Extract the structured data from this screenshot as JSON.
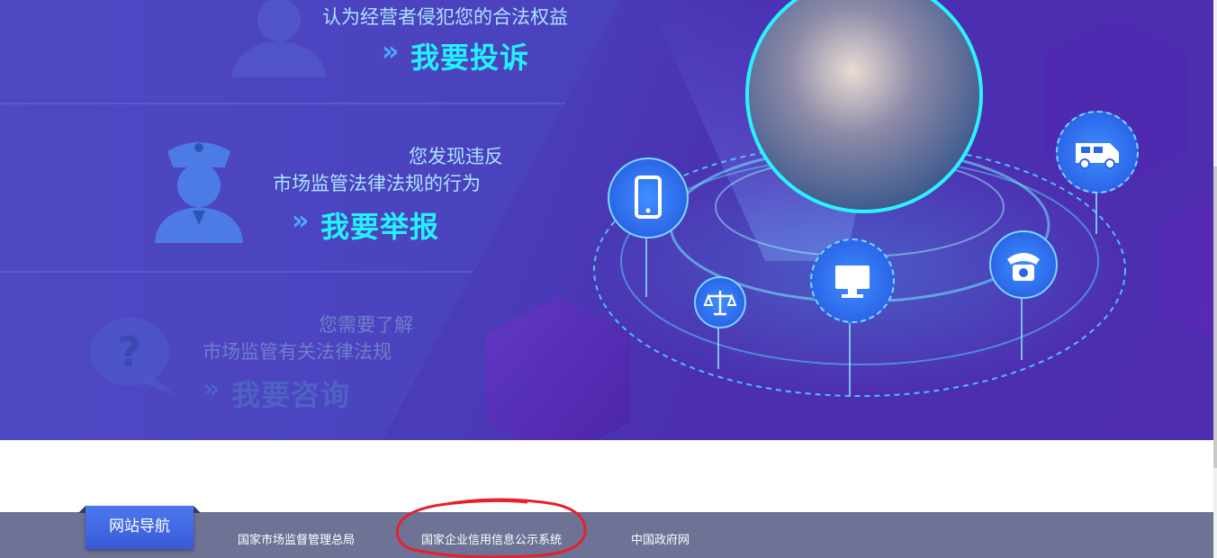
{
  "hero": {
    "complaint": {
      "desc": "认为经营者侵犯您的合法权益",
      "action": "我要投诉"
    },
    "report": {
      "desc_line1": "您发现违反",
      "desc_line2": "市场监管法律法规的行为",
      "action": "我要举报"
    },
    "consult": {
      "desc_line1": "您需要了解",
      "desc_line2": "市场监管有关法律法规",
      "action": "我要咨询"
    },
    "chevron": "»",
    "icons": [
      "customer-service-avatar-icon",
      "police-officer-icon",
      "question-bubble-icon",
      "mobile-phone-icon",
      "scales-of-justice-icon",
      "monitor-icon",
      "telephone-icon",
      "van-icon"
    ]
  },
  "footer": {
    "nav_label": "网站导航",
    "links": [
      {
        "label": "国家市场监督管理总局"
      },
      {
        "label": "国家企业信用信息公示系统"
      },
      {
        "label": "中国政府网"
      }
    ]
  },
  "colors": {
    "hero_bg": "#4a3bb7",
    "accent_cyan": "#22f2ff",
    "footer_bg": "#6e7396",
    "nav_label_bg": "#3a5ad8",
    "annotation_red": "#e8202a"
  }
}
